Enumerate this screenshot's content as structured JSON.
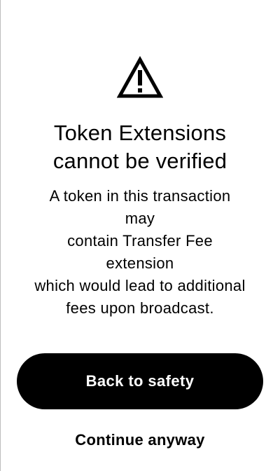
{
  "warning": {
    "icon": "warning-triangle-icon"
  },
  "title": {
    "line1": "Token Extensions",
    "line2": "cannot be verified"
  },
  "message": {
    "lines": [
      "A token in this transaction",
      "may",
      "contain Transfer Fee",
      "extension",
      "which would lead to additional",
      "fees upon broadcast."
    ]
  },
  "actions": {
    "primary_label": "Back to safety",
    "secondary_label": "Continue anyway"
  },
  "colors": {
    "background": "#ffffff",
    "text": "#000000",
    "button_background": "#000000",
    "button_text": "#ffffff"
  }
}
